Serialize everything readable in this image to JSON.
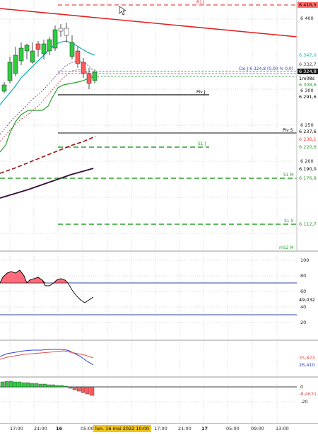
{
  "chart": {
    "price_axis": [
      "6 400",
      "6 300",
      "6 250",
      "6 200"
    ],
    "price_tags": [
      {
        "text": "6 416,5",
        "bg": "#ff6b6b",
        "color": "#000"
      },
      {
        "text": "6 347,0",
        "bg": "#ffffff",
        "color": "#1ab0b0"
      },
      {
        "text": "6 332,7",
        "bg": "#ffffff",
        "color": "#444"
      },
      {
        "text": "6 324,8",
        "bg": "#1a1a1a",
        "color": "#fff"
      },
      {
        "text": "1m08s",
        "bg": "#ffffff",
        "color": "#000"
      },
      {
        "text": "6 308,6",
        "bg": "#ffffff",
        "color": "#2aa02a"
      },
      {
        "text": "6 291,6",
        "bg": "#ffffff",
        "color": "#000"
      },
      {
        "text": "6 237,6",
        "bg": "#ffffff",
        "color": "#000"
      },
      {
        "text": "6 236,1",
        "bg": "#ffffff",
        "color": "#ff3b3b"
      },
      {
        "text": "6 220,6",
        "bg": "#ffffff",
        "color": "#2aa02a"
      },
      {
        "text": "6 190,0",
        "bg": "#ffffff",
        "color": "#000"
      },
      {
        "text": "6 176,8",
        "bg": "#ffffff",
        "color": "#2aa02a"
      },
      {
        "text": "6 112,7",
        "bg": "#ffffff",
        "color": "#2aa02a"
      }
    ],
    "level_labels": {
      "r1j": "R1 J",
      "clo": "Clo J 6 324,8 (0,00 % 0,0)",
      "s2m": "mS2 M",
      "pivj": "Piv J",
      "pivs": "Piv S",
      "s1j": "S1 J",
      "s1m": "S1 M",
      "s1s": "S1 S",
      "ms2m": "mS2 M"
    }
  },
  "oscillator1": {
    "axis": [
      "100",
      "80",
      "60",
      "40",
      "20"
    ],
    "value_tag": "49,032"
  },
  "oscillator2": {
    "tags": [
      "35,873",
      "26,410"
    ]
  },
  "oscillator3": {
    "axis": [
      "0",
      "-20"
    ],
    "value_tag": "-8,4631"
  },
  "time_axis": {
    "labels": [
      "17:00",
      "21:00",
      "16",
      "05:00",
      "17:00",
      "21:00",
      "17",
      "05:00",
      "09:00",
      "13:00"
    ],
    "cursor_date": "lun. 16 mai 2022 10:00"
  },
  "colors": {
    "bull": "#2ecc40",
    "bear": "#ff5c5c",
    "trend": "#e02020",
    "teal": "#1ab0b0",
    "green": "#2aa02a",
    "blue_line": "#3344aa"
  }
}
